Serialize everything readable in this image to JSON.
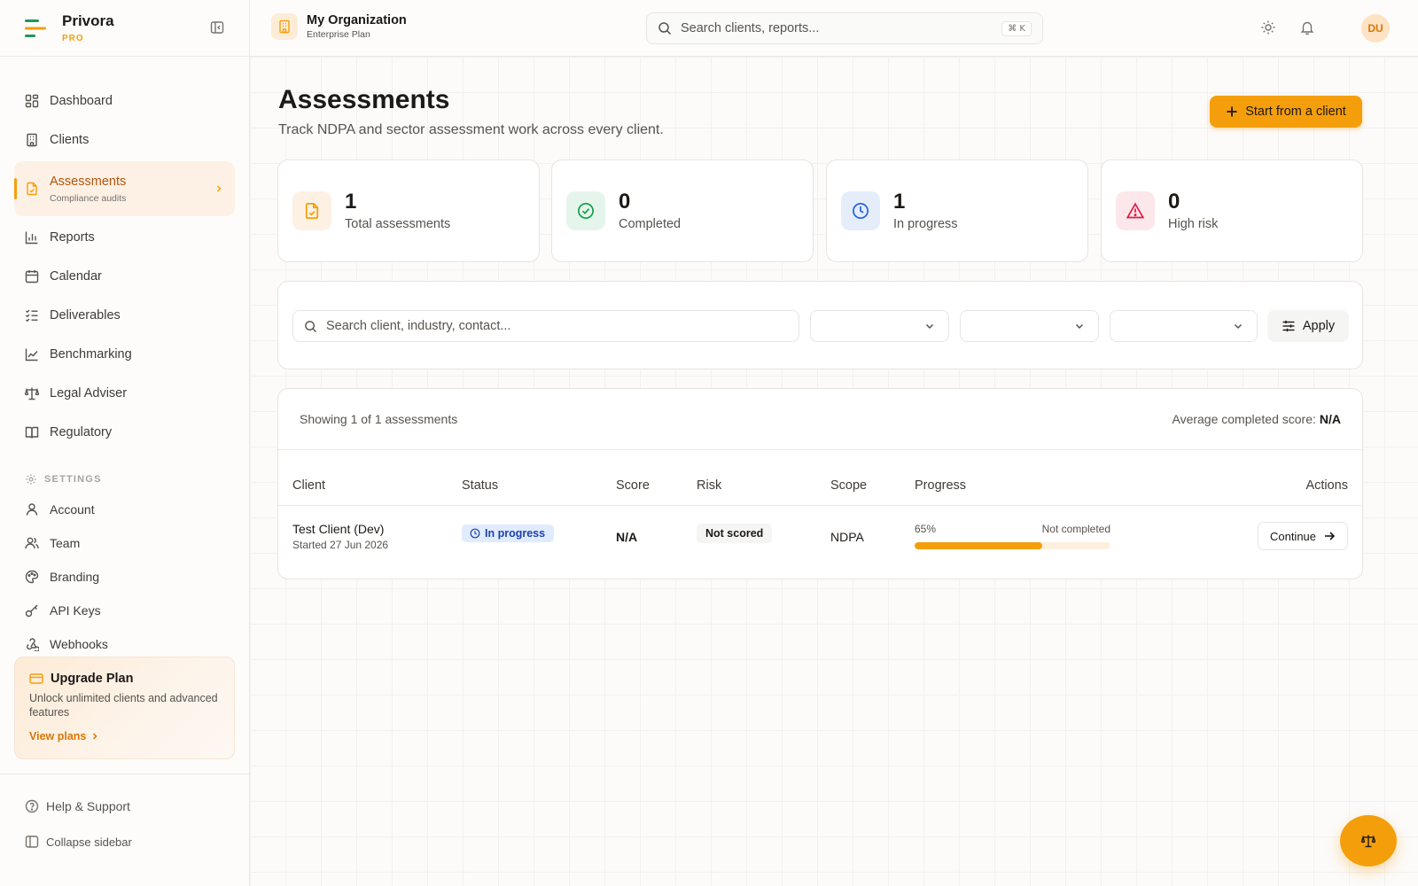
{
  "brand": {
    "name": "Privora",
    "tier": "PRO"
  },
  "org": {
    "name": "My Organization",
    "plan": "Enterprise Plan"
  },
  "search": {
    "placeholder": "Search clients, reports...",
    "shortcut": "⌘ K"
  },
  "user": {
    "initials": "DU"
  },
  "nav": [
    {
      "label": "Dashboard",
      "icon": "dashboard-icon"
    },
    {
      "label": "Clients",
      "icon": "building-icon"
    },
    {
      "label": "Assessments",
      "sub": "Compliance audits",
      "icon": "file-check-icon",
      "active": true
    },
    {
      "label": "Reports",
      "icon": "bar-chart-icon"
    },
    {
      "label": "Calendar",
      "icon": "calendar-icon"
    },
    {
      "label": "Deliverables",
      "icon": "list-check-icon"
    },
    {
      "label": "Benchmarking",
      "icon": "line-chart-icon"
    },
    {
      "label": "Legal Adviser",
      "icon": "scale-icon"
    },
    {
      "label": "Regulatory",
      "icon": "book-icon"
    }
  ],
  "settings": {
    "title": "SETTINGS",
    "items": [
      {
        "label": "Account",
        "icon": "user-icon"
      },
      {
        "label": "Team",
        "icon": "users-icon"
      },
      {
        "label": "Branding",
        "icon": "palette-icon"
      },
      {
        "label": "API Keys",
        "icon": "key-icon"
      },
      {
        "label": "Webhooks",
        "icon": "webhook-icon"
      }
    ]
  },
  "upgrade": {
    "title": "Upgrade Plan",
    "desc": "Unlock unlimited clients and advanced features",
    "link": "View plans"
  },
  "footer": {
    "help": "Help & Support",
    "collapse": "Collapse sidebar"
  },
  "page": {
    "title": "Assessments",
    "subtitle": "Track NDPA and sector assessment work across every client.",
    "primary_action": "Start from a client"
  },
  "stats": [
    {
      "value": "1",
      "label": "Total assessments",
      "icon": "file-check-icon",
      "color": "#f59e0b",
      "bg": "#fdf1e3"
    },
    {
      "value": "0",
      "label": "Completed",
      "icon": "check-circle-icon",
      "color": "#16a34a",
      "bg": "#e6f5ec"
    },
    {
      "value": "1",
      "label": "In progress",
      "icon": "clock-icon",
      "color": "#2563eb",
      "bg": "#e5edfb"
    },
    {
      "value": "0",
      "label": "High risk",
      "icon": "alert-triangle-icon",
      "color": "#e11d48",
      "bg": "#fce7ea"
    }
  ],
  "filters": {
    "search_placeholder": "Search client, industry, contact...",
    "selects": [
      "",
      "",
      ""
    ],
    "apply_label": "Apply"
  },
  "table": {
    "showing": "Showing 1 of 1 assessments",
    "avg_label": "Average completed score:",
    "avg_value": "N/A",
    "columns": [
      "Client",
      "Status",
      "Score",
      "Risk",
      "Scope",
      "Progress",
      "Actions"
    ],
    "rows": [
      {
        "client": "Test Client (Dev)",
        "started": "Started 27 Jun 2026",
        "status": "In progress",
        "score": "N/A",
        "risk": "Not scored",
        "scope": "NDPA",
        "progress_label": "65%",
        "progress": 65,
        "progress_status": "Not completed",
        "action": "Continue"
      }
    ]
  },
  "colors": {
    "accent": "#f59e0b",
    "accent_dark": "#d97706",
    "in_progress": "#1e40af"
  }
}
